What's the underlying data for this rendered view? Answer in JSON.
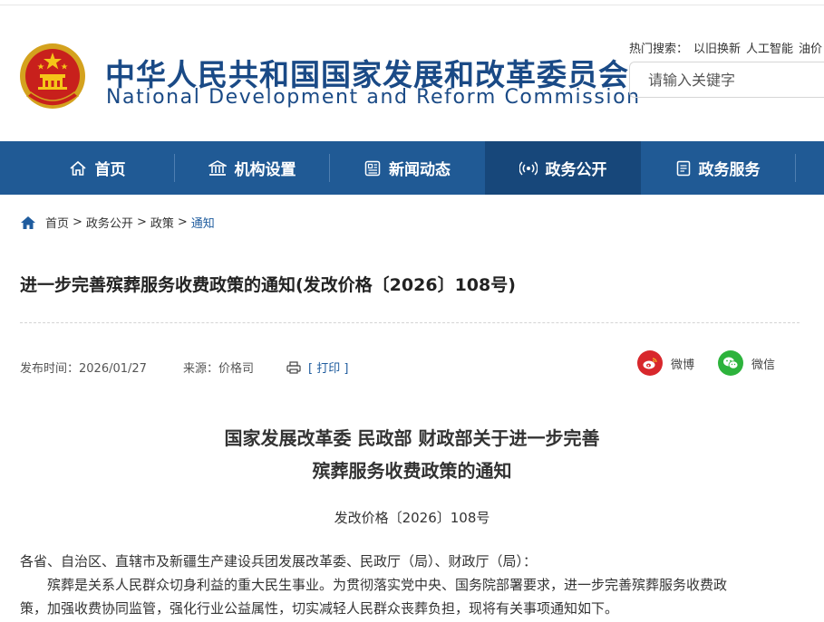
{
  "header": {
    "title_cn": "中华人民共和国国家发展和改革委员会",
    "title_en": "National Development and Reform Commission",
    "hot_label": "热门搜索：",
    "hot_terms": [
      "以旧换新",
      "人工智能",
      "油价"
    ],
    "search_placeholder": "请输入关键字"
  },
  "nav": {
    "items": [
      {
        "label": "首页",
        "icon": "home-icon"
      },
      {
        "label": "机构设置",
        "icon": "building-icon"
      },
      {
        "label": "新闻动态",
        "icon": "news-icon"
      },
      {
        "label": "政务公开",
        "icon": "broadcast-icon",
        "active": true
      },
      {
        "label": "政务服务",
        "icon": "service-icon"
      }
    ]
  },
  "breadcrumb": {
    "items": [
      "首页",
      "政务公开",
      "政策"
    ],
    "current": "通知",
    "separator": ">"
  },
  "article": {
    "title": "进一步完善殡葬服务收费政策的通知(发改价格〔2026〕108号)",
    "publish_time": "发布时间：2026/01/27",
    "source": "来源：价格司",
    "print_label": "[ 打印 ]",
    "share_weibo": "微博",
    "share_wechat": "微信"
  },
  "document": {
    "title_line1": "国家发展改革委 民政部 财政部关于进一步完善",
    "title_line2": "殡葬服务收费政策的通知",
    "doc_number": "发改价格〔2026〕108号",
    "addressee": "各省、自治区、直辖市及新疆生产建设兵团发展改革委、民政厅（局）、财政厅（局）：",
    "para1_line1": "　　殡葬是关系人民群众切身利益的重大民生事业。为贯彻落实党中央、国务院部署要求，进一步完善殡葬服务收费政",
    "para1_line2": "策，加强收费协同监管，强化行业公益属性，切实减轻人民群众丧葬负担，现将有关事项通知如下。"
  },
  "colors": {
    "brand_blue": "#1a4a86",
    "nav_bg": "#205a95",
    "nav_active": "#17477a",
    "link_blue": "#1f5c9e",
    "weibo_red": "#d8272c",
    "wechat_green": "#2db33c"
  }
}
